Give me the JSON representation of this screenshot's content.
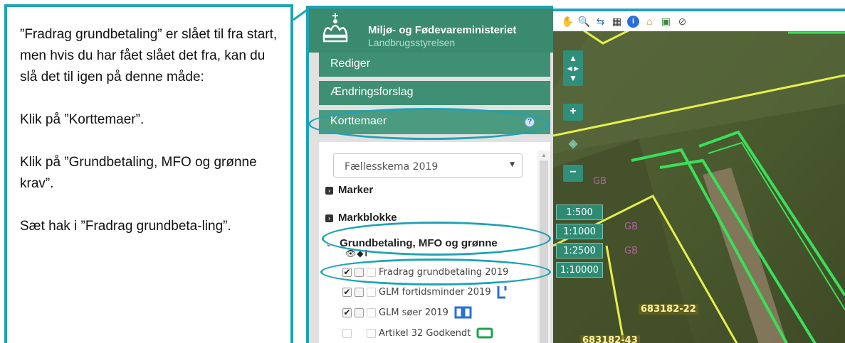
{
  "instructions": {
    "p1": "”Fradrag grundbetaling” er slået til fra start, men hvis du har fået slået det fra, kan du slå det til igen på denne måde:",
    "p2": "Klik på ”Korttemaer”.",
    "p3": "Klik på ”Grundbetaling, MFO og grønne krav”.",
    "p4": "Sæt hak i ”Fradrag grundbeta-ling”."
  },
  "brand": {
    "title": "Miljø- og Fødevareministeriet",
    "subtitle": "Landbrugsstyrelsen"
  },
  "menu": {
    "rediger": "Rediger",
    "aendringsforslag": "Ændringsforslag",
    "korttemaer": "Korttemaer"
  },
  "layers": {
    "selected_scheme": "Fællesskema 2019",
    "groups": {
      "marker": "Marker",
      "markblokke": "Markblokke",
      "grundbetaling": "Grundbetaling, MFO og grønne"
    },
    "items": [
      {
        "label": "Fradrag grundbetaling 2019",
        "checked": true
      },
      {
        "label": "GLM fortidsminder 2019",
        "checked": true,
        "legend_color": "#2a6fd6"
      },
      {
        "label": "GLM søer 2019",
        "checked": true,
        "legend_color": "#2a6fd6"
      },
      {
        "label": "Artikel 32 Godkendt",
        "checked": false,
        "legend_color": "#1aa34a"
      }
    ]
  },
  "map": {
    "scales": [
      "1:500",
      "1:1000",
      "1:2500",
      "1:10000"
    ],
    "parcels": [
      "683182-22",
      "683182-43"
    ],
    "toolbar_icons": [
      "pan-hand-icon",
      "zoom-icon",
      "measure-icon",
      "layers-icon",
      "info-icon",
      "home-icon",
      "map-icon",
      "clear-icon"
    ]
  },
  "colors": {
    "accent": "#1fa3b4",
    "brand_green": "#3a8a70",
    "field_outline_green": "#39e05a",
    "field_outline_yellow": "#e6f04a"
  }
}
